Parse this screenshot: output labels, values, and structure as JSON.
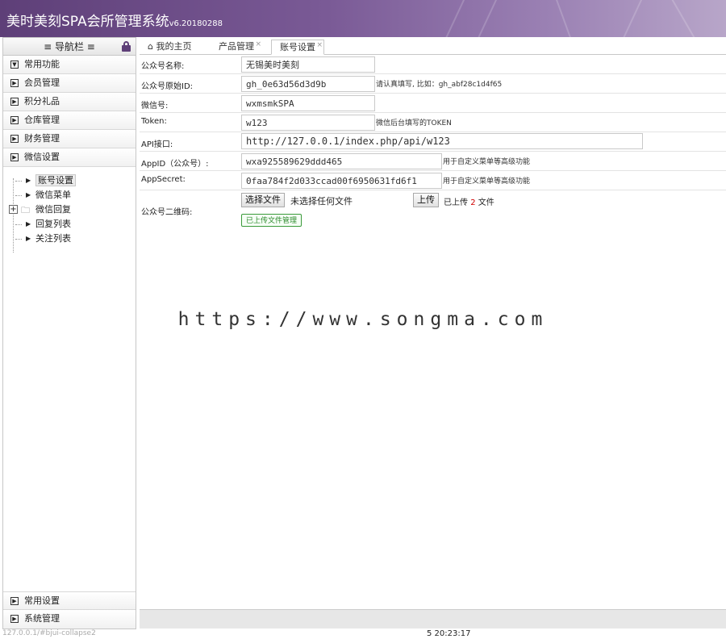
{
  "app": {
    "title": "美时美刻SPA会所管理系统",
    "version": "v6.20180288"
  },
  "sidebar": {
    "heading": "≡ 导航栏 ≡",
    "menu_top": [
      {
        "label": "常用功能"
      },
      {
        "label": "会员管理"
      },
      {
        "label": "积分礼品"
      },
      {
        "label": "仓库管理"
      },
      {
        "label": "财务管理"
      },
      {
        "label": "微信设置"
      }
    ],
    "tree": [
      {
        "label": "账号设置",
        "selected": true
      },
      {
        "label": "微信菜单"
      },
      {
        "label": "微信回复",
        "folder": true
      },
      {
        "label": "回复列表"
      },
      {
        "label": "关注列表"
      }
    ],
    "menu_bottom": [
      {
        "label": "常用设置"
      },
      {
        "label": "系统管理"
      }
    ]
  },
  "tabs": [
    {
      "label": "我的主页",
      "icon": "home-icon"
    },
    {
      "label": "产品管理",
      "closable": true
    },
    {
      "label": "账号设置",
      "closable": true,
      "active": true
    }
  ],
  "form": {
    "account_name": {
      "label": "公众号名称:",
      "value": "无锡美时美刻"
    },
    "original_id": {
      "label": "公众号原始ID:",
      "value": "gh_0e63d56d3d9b",
      "hint": "请认真填写, 比如：gh_abf28c1d4f65"
    },
    "wechat_no": {
      "label": "微信号:",
      "value": "wxmsmkSPA"
    },
    "token": {
      "label": "Token:",
      "value": "w123",
      "hint": "微信后台填写的TOKEN"
    },
    "api": {
      "label": "API接口:",
      "value": "http://127.0.0.1/index.php/api/w123"
    },
    "appid": {
      "label": "AppID（公众号）:",
      "value": "wxa925589629ddd465",
      "hint": "用于自定义菜单等高级功能"
    },
    "appsecret": {
      "label": "AppSecret:",
      "value": "0faa784f2d033ccad00f6950631fd6f1",
      "hint": "用于自定义菜单等高级功能"
    },
    "qrcode": {
      "label": "公众号二维码:",
      "choose_button": "选择文件",
      "no_file_text": "未选择任何文件",
      "upload_button": "上传",
      "uploaded_prefix": "已上传",
      "uploaded_count": "2",
      "uploaded_suffix": "文件",
      "manage_button": "已上传文件管理"
    }
  },
  "watermark": "https://www.songma.com",
  "statusbar": {
    "url": "127.0.0.1/#bjui-collapse2",
    "time": "5 20:23:17"
  },
  "colors": {
    "header_start": "#5e3f78",
    "header_end": "#b8a6c9",
    "upload_count": "#d00000",
    "manage_green": "#2d8a2d"
  }
}
